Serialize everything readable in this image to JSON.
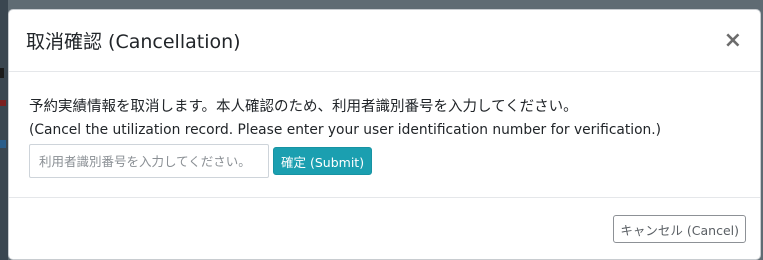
{
  "modal": {
    "title": "取消確認 (Cancellation)",
    "close_glyph": "×",
    "message_ja": "予約実績情報を取消します。本人確認のため、利用者識別番号を入力してください。",
    "message_en": "(Cancel the utilization record. Please enter your user identification number for verification.)",
    "input": {
      "placeholder": "利用者識別番号を入力してください。",
      "value": ""
    },
    "submit_label": "確定 (Submit)",
    "cancel_label": "キャンセル (Cancel)"
  },
  "colors": {
    "submit_bg": "#1b9fb0",
    "backdrop": "#5f6b73"
  },
  "icons": {
    "close": "close-icon"
  }
}
